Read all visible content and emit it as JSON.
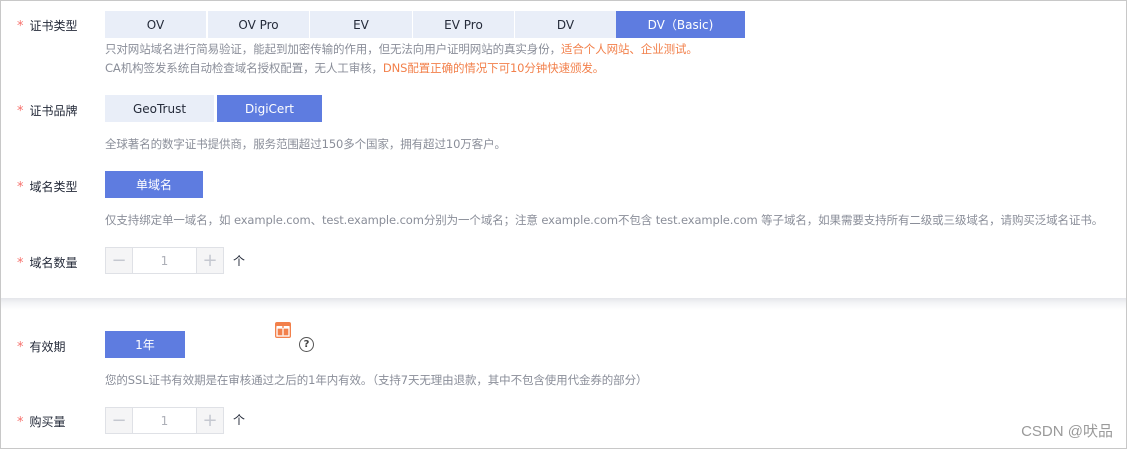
{
  "cert_type": {
    "label": "证书类型",
    "options": [
      "OV",
      "OV Pro",
      "EV",
      "EV Pro",
      "DV",
      "DV（Basic)"
    ],
    "selected": "DV（Basic)",
    "hint_line1_plain": "只对网站域名进行简易验证，能起到加密传输的作用，但无法向用户证明网站的真实身份，",
    "hint_line1_highlight": "适合个人网站、企业测试。",
    "hint_line2_plain": "CA机构签发系统自动检查域名授权配置，无人工审核，",
    "hint_line2_highlight": "DNS配置正确的情况下可10分钟快速颁发。"
  },
  "cert_brand": {
    "label": "证书品牌",
    "options": [
      "GeoTrust",
      "DigiCert"
    ],
    "selected": "DigiCert",
    "hint": "全球著名的数字证书提供商，服务范围超过150多个国家，拥有超过10万客户。"
  },
  "domain_type": {
    "label": "域名类型",
    "options": [
      "单域名"
    ],
    "selected": "单域名",
    "hint": "仅支持绑定单一域名，如 example.com、test.example.com分别为一个域名；注意 example.com不包含 test.example.com 等子域名，如果需要支持所有二级或三级域名，请购买泛域名证书。"
  },
  "domain_count": {
    "label": "域名数量",
    "value": "1",
    "unit": "个",
    "minus": "−",
    "plus": "+"
  },
  "validity": {
    "label": "有效期",
    "options": [
      "1年"
    ],
    "selected": "1年",
    "help": "?",
    "hint": "您的SSL证书有效期是在审核通过之后的1年内有效。（支持7天无理由退款，其中不包含使用代金券的部分）"
  },
  "purchase_qty": {
    "label": "购买量",
    "value": "1",
    "unit": "个",
    "minus": "−",
    "plus": "+"
  },
  "required_mark": "*",
  "watermark": "CSDN @吠品",
  "colors": {
    "accent": "#5e7ce0",
    "button_bg": "#e9eef8",
    "highlight": "#f2804b",
    "required": "#f66f6a",
    "hint": "#8a8e99"
  }
}
